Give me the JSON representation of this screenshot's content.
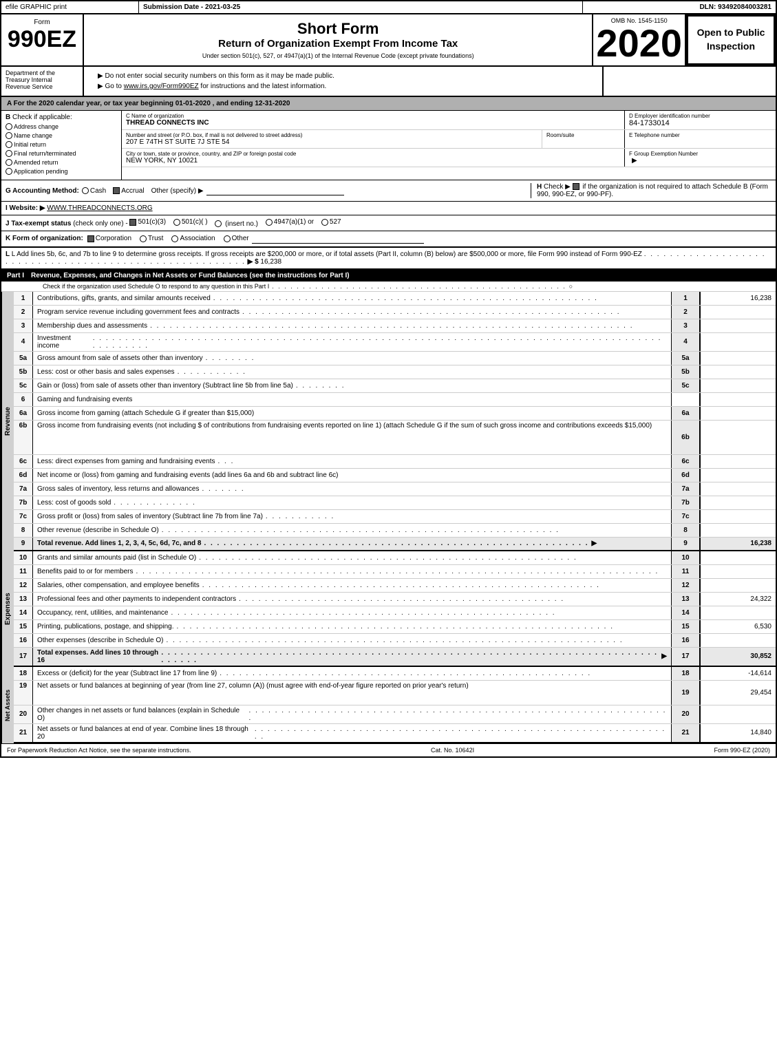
{
  "header": {
    "efile": "efile GRAPHIC print",
    "submission_date_label": "Submission Date -",
    "submission_date": "2021-03-25",
    "dln_label": "DLN:",
    "dln": "93492084003281"
  },
  "form": {
    "number": "990EZ",
    "dept": "Department of the Treasury Internal Revenue Service",
    "short_form_title": "Short Form",
    "return_title": "Return of Organization Exempt From Income Tax",
    "under_section": "Under section 501(c), 527, or 4947(a)(1) of the Internal Revenue Code (except private foundations)",
    "ssn_notice": "▶ Do not enter social security numbers on this form as it may be made public.",
    "goto_notice": "▶ Go to www.irs.gov/Form990EZ for instructions and the latest information.",
    "goto_url": "www.irs.gov/Form990EZ",
    "year": "2020",
    "omb": "OMB No. 1545-1150",
    "open_to_public": "Open to Public Inspection"
  },
  "section_a": {
    "text": "A  For the 2020 calendar year, or tax year beginning 01-01-2020 , and ending 12-31-2020"
  },
  "section_b": {
    "label": "B",
    "check_label": "Check if applicable:",
    "checks": [
      {
        "id": "address_change",
        "label": "Address change",
        "checked": false
      },
      {
        "id": "name_change",
        "label": "Name change",
        "checked": false
      },
      {
        "id": "initial_return",
        "label": "Initial return",
        "checked": false
      },
      {
        "id": "final_return",
        "label": "Final return/terminated",
        "checked": false
      },
      {
        "id": "amended_return",
        "label": "Amended return",
        "checked": false
      },
      {
        "id": "app_pending",
        "label": "Application pending",
        "checked": false
      }
    ]
  },
  "org": {
    "c_label": "C Name of organization",
    "name": "THREAD CONNECTS INC",
    "address_label": "Number and street (or P.O. box, if mail is not delivered to street address)",
    "address": "207 E 74TH ST SUITE 7J STE 54",
    "room_label": "Room/suite",
    "room": "",
    "city_label": "City or town, state or province, country, and ZIP or foreign postal code",
    "city": "NEW YORK, NY  10021",
    "d_label": "D Employer identification number",
    "ein": "84-1733014",
    "e_label": "E Telephone number",
    "phone": "",
    "f_label": "F Group Exemption Number",
    "group_exempt": ""
  },
  "accounting": {
    "g_label": "G Accounting Method:",
    "cash": "Cash",
    "accrual": "Accrual",
    "accrual_checked": true,
    "other": "Other (specify) ▶",
    "h_label": "H",
    "h_text": "Check ▶",
    "h_checked": true,
    "h_desc": "if the organization is not required to attach Schedule B (Form 990, 990-EZ, or 990-PF)."
  },
  "website": {
    "i_label": "I Website: ▶",
    "url": "WWW.THREADCONNECTS.ORG"
  },
  "tax_status": {
    "j_label": "J Tax-exempt status",
    "check_note": "(check only one) -",
    "options": [
      {
        "label": "501(c)(3)",
        "checked": true
      },
      {
        "label": "501(c)(  )",
        "checked": false
      },
      {
        "label": "(insert no.)",
        "checked": false
      },
      {
        "label": "4947(a)(1) or",
        "checked": false
      },
      {
        "label": "527",
        "checked": false
      }
    ]
  },
  "form_org": {
    "k_label": "K Form of organization:",
    "options": [
      {
        "label": "Corporation",
        "checked": true
      },
      {
        "label": "Trust",
        "checked": false
      },
      {
        "label": "Association",
        "checked": false
      },
      {
        "label": "Other",
        "checked": false
      }
    ]
  },
  "line_l": {
    "text": "L Add lines 5b, 6c, and 7b to line 9 to determine gross receipts. If gross receipts are $200,000 or more, or if total assets (Part II, column (B) below) are $500,000 or more, file Form 990 instead of Form 990-EZ",
    "arrow": "▶ $",
    "amount": "16,238"
  },
  "part_i": {
    "label": "Part I",
    "title": "Revenue, Expenses, and Changes in Net Assets or Fund Balances",
    "see_instructions": "(see the instructions for Part I)",
    "check_line": "Check if the organization used Schedule O to respond to any question in this Part I",
    "lines": [
      {
        "num": "1",
        "desc": "Contributions, gifts, grants, and similar amounts received",
        "ref": "1",
        "amount": "16,238"
      },
      {
        "num": "2",
        "desc": "Program service revenue including government fees and contracts",
        "ref": "2",
        "amount": ""
      },
      {
        "num": "3",
        "desc": "Membership dues and assessments",
        "ref": "3",
        "amount": ""
      },
      {
        "num": "4",
        "desc": "Investment income",
        "ref": "4",
        "amount": ""
      },
      {
        "num": "5a",
        "desc": "Gross amount from sale of assets other than inventory",
        "ref": "5a",
        "amount": ""
      },
      {
        "num": "5b",
        "desc": "Less: cost or other basis and sales expenses",
        "ref": "5b",
        "amount": ""
      },
      {
        "num": "5c",
        "desc": "Gain or (loss) from sale of assets other than inventory (Subtract line 5b from line 5a)",
        "ref": "5c",
        "amount": ""
      },
      {
        "num": "6",
        "desc": "Gaming and fundraising events",
        "ref": "",
        "amount": ""
      },
      {
        "num": "6a",
        "desc": "Gross income from gaming (attach Schedule G if greater than $15,000)",
        "ref": "6a",
        "amount": ""
      },
      {
        "num": "6b",
        "desc": "Gross income from fundraising events (not including $                    of contributions from fundraising events reported on line 1) (attach Schedule G if the sum of such gross income and contributions exceeds $15,000)",
        "ref": "6b",
        "amount": ""
      },
      {
        "num": "6c",
        "desc": "Less: direct expenses from gaming and fundraising events",
        "ref": "6c",
        "amount": ""
      },
      {
        "num": "6d",
        "desc": "Net income or (loss) from gaming and fundraising events (add lines 6a and 6b and subtract line 6c)",
        "ref": "6d",
        "amount": ""
      },
      {
        "num": "7a",
        "desc": "Gross sales of inventory, less returns and allowances",
        "ref": "7a",
        "amount": ""
      },
      {
        "num": "7b",
        "desc": "Less: cost of goods sold",
        "ref": "7b",
        "amount": ""
      },
      {
        "num": "7c",
        "desc": "Gross profit or (loss) from sales of inventory (Subtract line 7b from line 7a)",
        "ref": "7c",
        "amount": ""
      },
      {
        "num": "8",
        "desc": "Other revenue (describe in Schedule O)",
        "ref": "8",
        "amount": ""
      },
      {
        "num": "9",
        "desc": "Total revenue. Add lines 1, 2, 3, 4, 5c, 6d, 7c, and 8",
        "ref": "9",
        "amount": "16,238",
        "bold": true,
        "arrow": true
      }
    ]
  },
  "part_i_expenses": {
    "lines": [
      {
        "num": "10",
        "desc": "Grants and similar amounts paid (list in Schedule O)",
        "ref": "10",
        "amount": ""
      },
      {
        "num": "11",
        "desc": "Benefits paid to or for members",
        "ref": "11",
        "amount": ""
      },
      {
        "num": "12",
        "desc": "Salaries, other compensation, and employee benefits",
        "ref": "12",
        "amount": ""
      },
      {
        "num": "13",
        "desc": "Professional fees and other payments to independent contractors",
        "ref": "13",
        "amount": "24,322"
      },
      {
        "num": "14",
        "desc": "Occupancy, rent, utilities, and maintenance",
        "ref": "14",
        "amount": ""
      },
      {
        "num": "15",
        "desc": "Printing, publications, postage, and shipping.",
        "ref": "15",
        "amount": "6,530"
      },
      {
        "num": "16",
        "desc": "Other expenses (describe in Schedule O)",
        "ref": "16",
        "amount": ""
      },
      {
        "num": "17",
        "desc": "Total expenses. Add lines 10 through 16",
        "ref": "17",
        "amount": "30,852",
        "bold": true,
        "arrow": true
      }
    ]
  },
  "part_i_net": {
    "lines": [
      {
        "num": "18",
        "desc": "Excess or (deficit) for the year (Subtract line 17 from line 9)",
        "ref": "18",
        "amount": "-14,614"
      },
      {
        "num": "19",
        "desc": "Net assets or fund balances at beginning of year (from line 27, column (A)) (must agree with end-of-year figure reported on prior year's return)",
        "ref": "19",
        "amount": "29,454"
      },
      {
        "num": "20",
        "desc": "Other changes in net assets or fund balances (explain in Schedule O)",
        "ref": "20",
        "amount": ""
      },
      {
        "num": "21",
        "desc": "Net assets or fund balances at end of year. Combine lines 18 through 20",
        "ref": "21",
        "amount": "14,840"
      }
    ]
  },
  "footer": {
    "paperwork_text": "For Paperwork Reduction Act Notice, see the separate instructions.",
    "cat_no": "Cat. No. 10642I",
    "form_ref": "Form 990-EZ (2020)"
  }
}
